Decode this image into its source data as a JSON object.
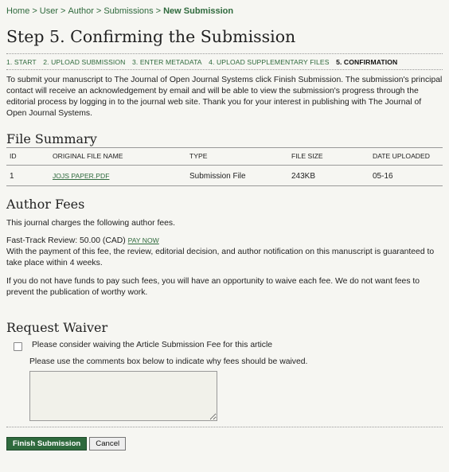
{
  "breadcrumb": {
    "items": [
      "Home",
      "User",
      "Author",
      "Submissions"
    ],
    "current": "New Submission",
    "separator": ">"
  },
  "page": {
    "title": "Step 5. Confirming the Submission"
  },
  "steps": [
    {
      "label": "1. Start",
      "active": false
    },
    {
      "label": "2. Upload Submission",
      "active": false
    },
    {
      "label": "3. Enter Metadata",
      "active": false
    },
    {
      "label": "4. Upload Supplementary Files",
      "active": false
    },
    {
      "label": "5. Confirmation",
      "active": true
    }
  ],
  "intro": "To submit your manuscript to The Journal of Open Journal Systems click Finish Submission. The submission's principal contact will receive an acknowledgement by email and will be able to view the submission's progress through the editorial process by logging in to the journal web site. Thank you for your interest in publishing with The Journal of Open Journal Systems.",
  "file_summary": {
    "heading": "File Summary",
    "columns": [
      "ID",
      "Original file name",
      "Type",
      "File Size",
      "Date Uploaded"
    ],
    "rows": [
      {
        "id": "1",
        "name": "JOJS PAPER.PDF",
        "type": "Submission File",
        "size": "243KB",
        "date": "05-16"
      }
    ]
  },
  "author_fees": {
    "heading": "Author Fees",
    "intro": "This journal charges the following author fees.",
    "fee_label": "Fast-Track Review: 50.00 (CAD)",
    "pay_now": "PAY NOW",
    "fee_description": "With the payment of this fee, the review, editorial decision, and author notification on this manuscript is guaranteed to take place within 4 weeks.",
    "waive_note": "If you do not have funds to pay such fees, you will have an opportunity to waive each fee. We do not want fees to prevent the publication of worthy work."
  },
  "waiver": {
    "heading": "Request Waiver",
    "checkbox_label": "Please consider waiving the Article Submission Fee for this article",
    "comment_note": "Please use the comments box below to indicate why fees should be waived.",
    "comments_value": ""
  },
  "buttons": {
    "finish": "Finish Submission",
    "cancel": "Cancel"
  },
  "colors": {
    "accent": "#2f6a3d",
    "background": "#f6f6f2"
  }
}
